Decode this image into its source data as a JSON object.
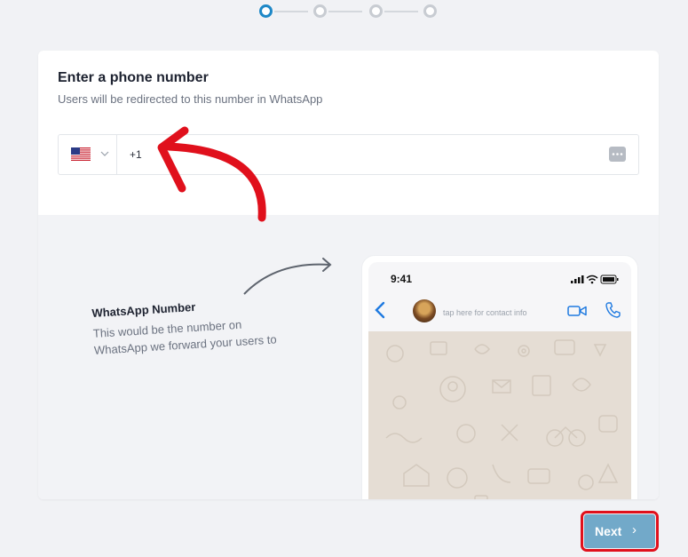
{
  "stepper": {
    "steps": 4,
    "current": 1
  },
  "form": {
    "title": "Enter a phone number",
    "subtitle": "Users will be redirected to this number in WhatsApp",
    "country_flag": "us-flag-icon",
    "phone_value": "+1"
  },
  "preview": {
    "hint_title": "WhatsApp Number",
    "hint_desc": "This would be the number on WhatsApp we forward your users to",
    "phone": {
      "time": "9:41",
      "contact_info": "tap here for contact info"
    }
  },
  "actions": {
    "next_label": "Next",
    "next_icon": "›"
  },
  "colors": {
    "accent": "#1e88c7",
    "next_button": "#72a9c9",
    "annotation": "#e0101c",
    "chat_background": "#e5ddd4"
  }
}
